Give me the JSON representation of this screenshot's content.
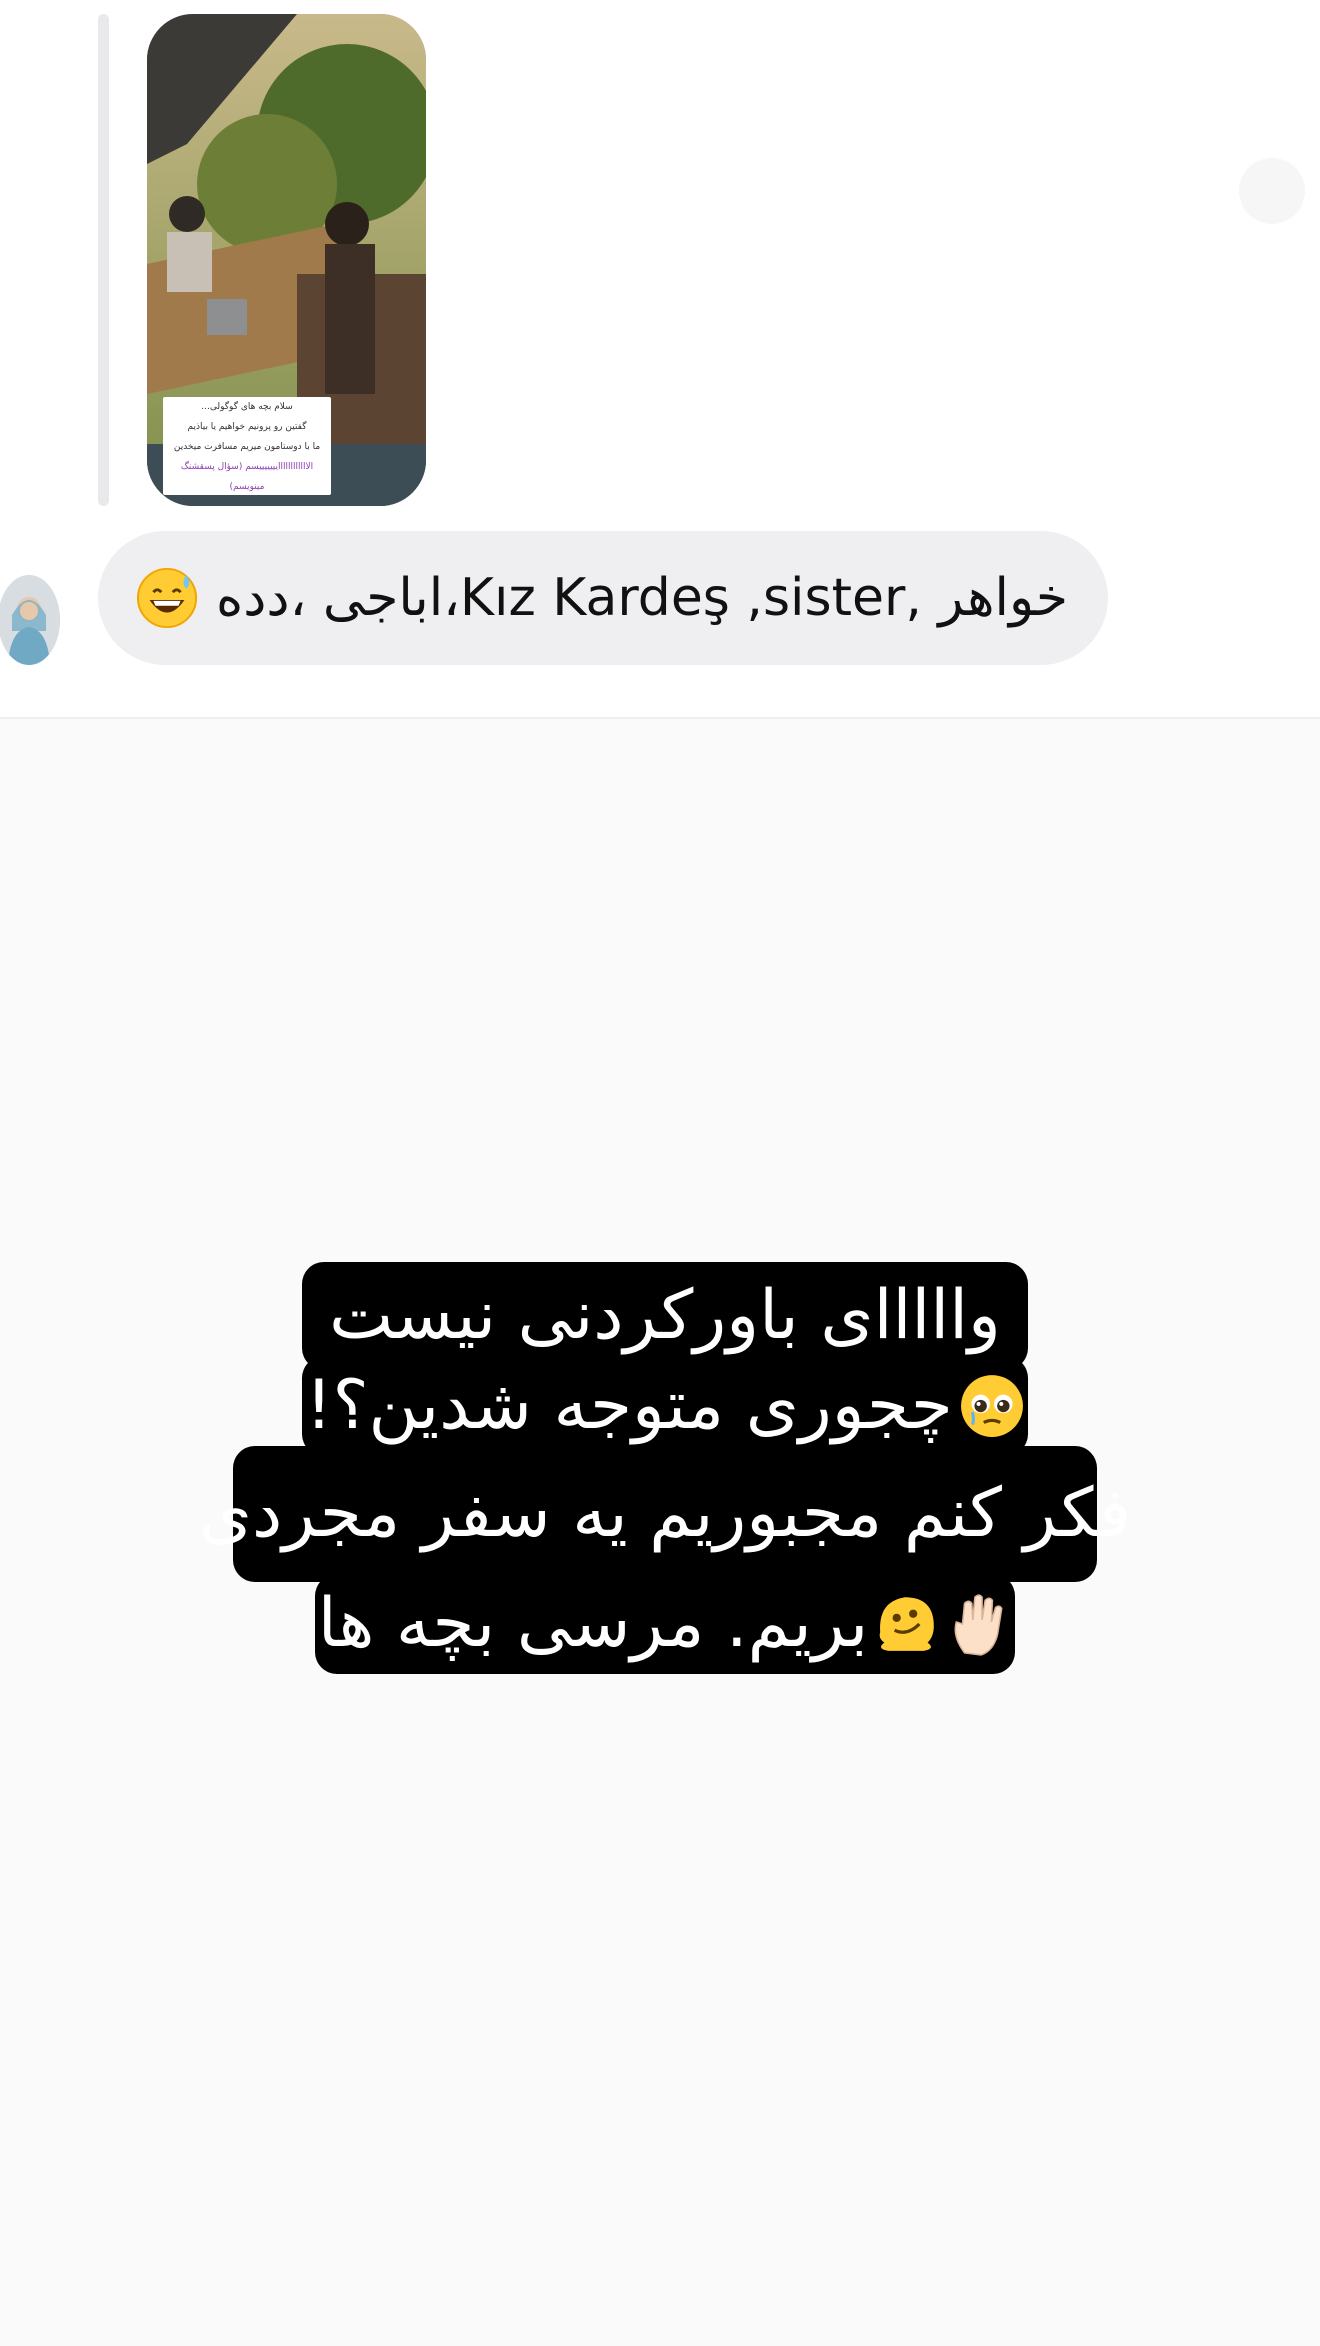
{
  "story_reply": {
    "caption_lines": [
      "سلام بچه های گوگولی...",
      "گفتین رو پرونیم خواهیم یا بیاذیم",
      "ما با دوستامون میریم مسافرت میخدین",
      "الاااااااااااایییییییسم (سؤال پسقشنگ مینویسم)"
    ]
  },
  "message": {
    "text": "خواهر ,Kız Kardeş ,sister،اباجی ،دده",
    "emoji_icon": "grinning-sweat-emoji"
  },
  "story_text": {
    "line1": "وااااای باورکردنی نیست",
    "line2": "چجوری متوجه شدین؟!",
    "line3": "فکر کنم مجبوریم یه سفر مجردی",
    "line4": "بریم. مرسی بچه ها"
  },
  "colors": {
    "bubble_bg": "#efeff2",
    "story_text_bg": "#000000",
    "story_text_fg": "#ffffff",
    "page_bg": "#fafafa"
  }
}
